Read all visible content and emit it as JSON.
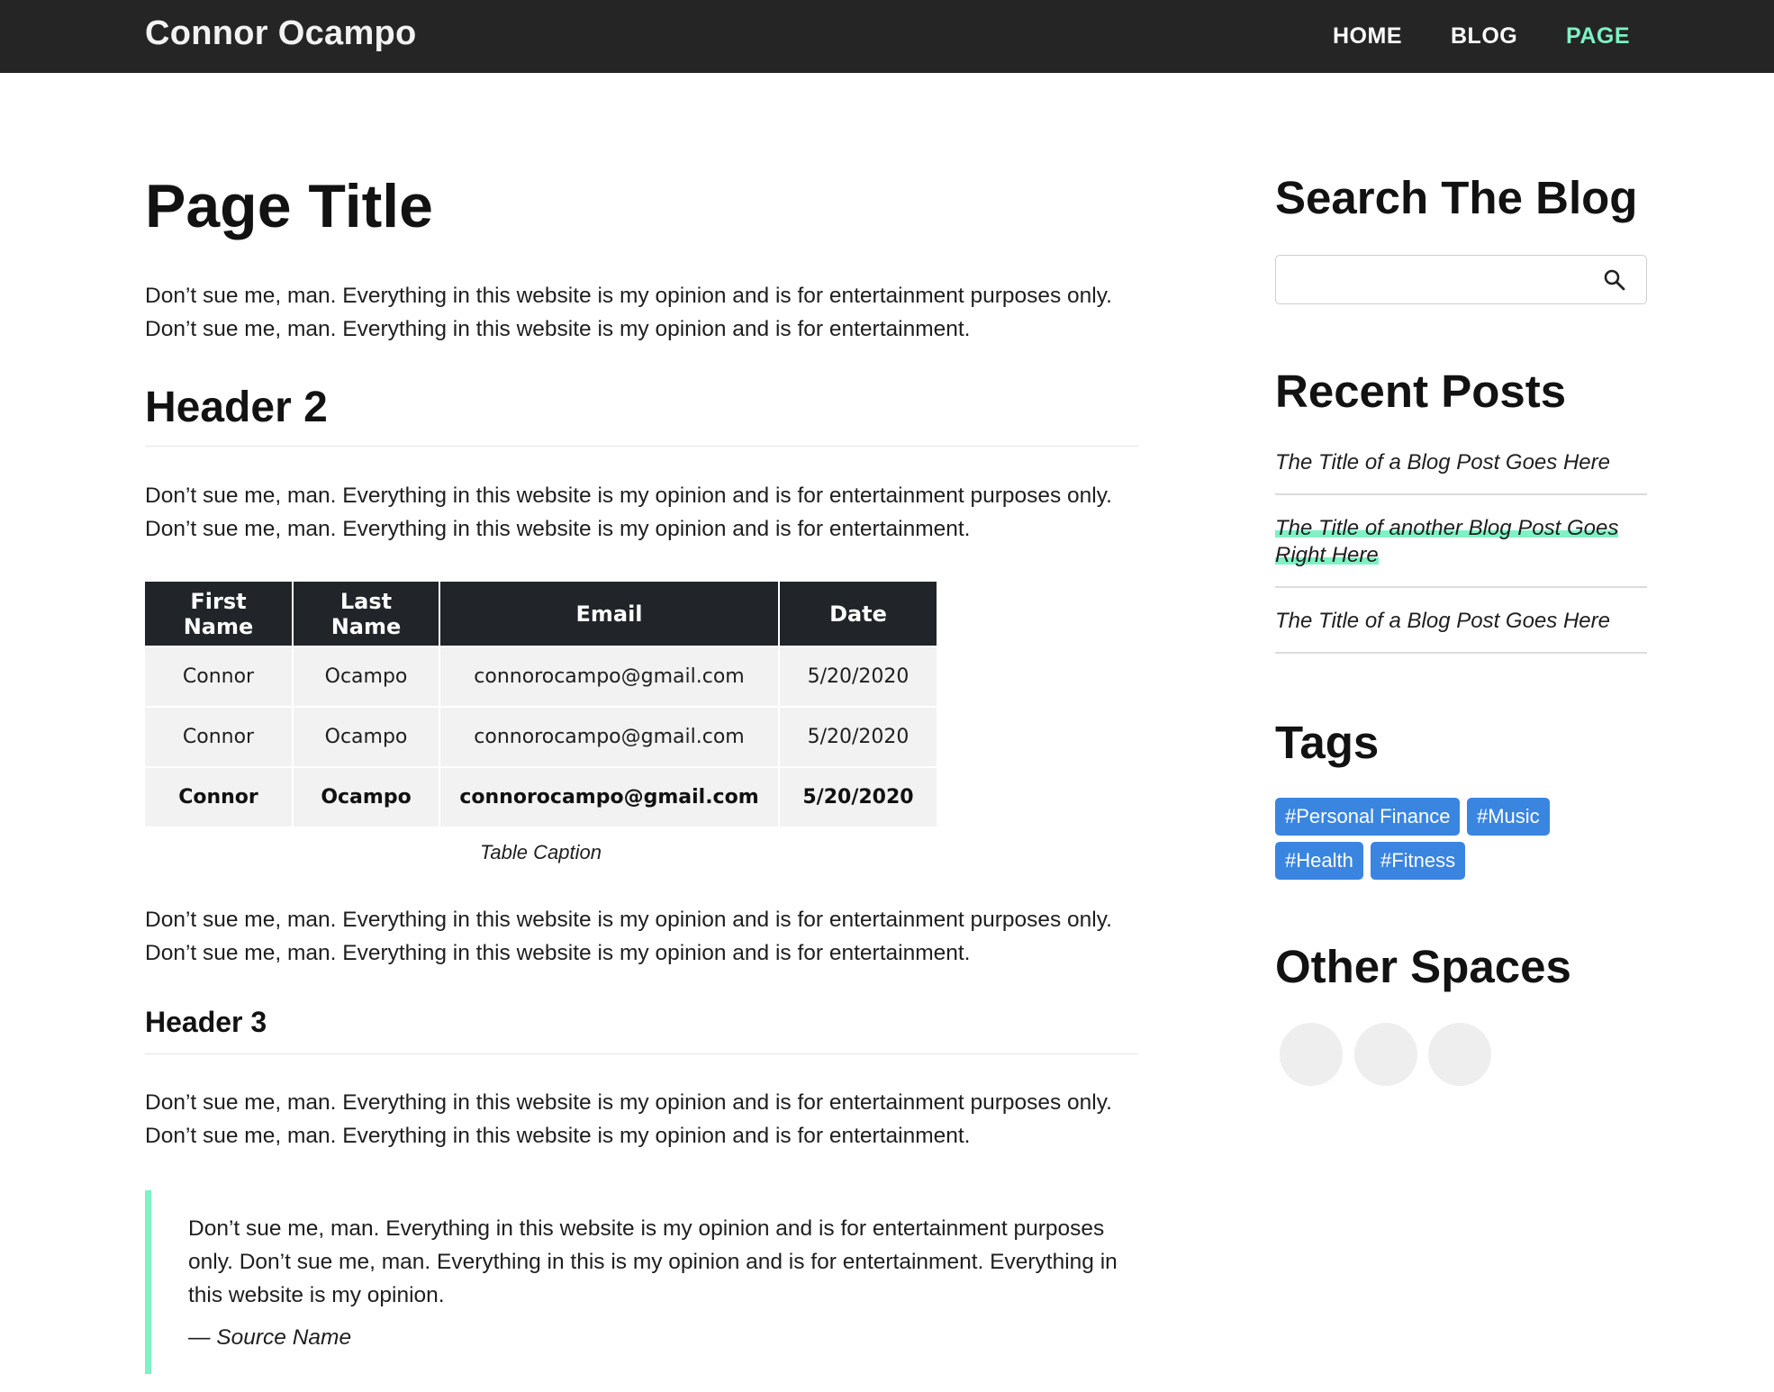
{
  "header": {
    "brand": "Connor Ocampo",
    "nav": [
      {
        "label": "HOME",
        "active": false
      },
      {
        "label": "BLOG",
        "active": false
      },
      {
        "label": "PAGE",
        "active": true
      }
    ]
  },
  "main": {
    "title": "Page Title",
    "paragraphs": [
      "Don’t sue me, man. Everything in this website is my opinion and is for entertainment purposes only. Don’t sue me, man. Everything in this website is my opinion and is for entertainment.",
      "Don’t sue me, man. Everything in this website is my opinion and is for entertainment purposes only. Don’t sue me, man. Everything in this website is my opinion and is for entertainment.",
      "Don’t sue me, man. Everything in this website is my opinion and is for entertainment purposes only. Don’t sue me, man. Everything in this website is my opinion and is for entertainment.",
      "Don’t sue me, man. Everything in this website is my opinion and is for entertainment purposes only. Don’t sue me, man. Everything in this website is my opinion and is for entertainment."
    ],
    "header2": "Header 2",
    "header3": "Header 3",
    "table": {
      "columns": [
        "First Name",
        "Last Name",
        "Email",
        "Date"
      ],
      "rows": [
        [
          "Connor",
          "Ocampo",
          "connorocampo@gmail.com",
          "5/20/2020"
        ],
        [
          "Connor",
          "Ocampo",
          "connorocampo@gmail.com",
          "5/20/2020"
        ],
        [
          "Connor",
          "Ocampo",
          "connorocampo@gmail.com",
          "5/20/2020"
        ]
      ],
      "caption": "Table Caption"
    },
    "quote": {
      "text": "Don’t sue me, man. Everything in this website is my opinion and is for entertainment purposes only. Don’t sue me, man. Everything in this is my opinion and is for entertainment. Everything in this website is my opinion.",
      "source": "— Source Name"
    }
  },
  "sidebar": {
    "search_heading": "Search The Blog",
    "search_placeholder": "",
    "recent_heading": "Recent Posts",
    "recent_posts": [
      "The Title of a Blog Post Goes Here",
      "The Title of another Blog Post Goes Right Here",
      "The Title of a Blog Post Goes Here"
    ],
    "tags_heading": "Tags",
    "tags": [
      "#Personal Finance",
      "#Music",
      "#Health",
      "#Fitness"
    ],
    "other_heading": "Other Spaces"
  },
  "colors": {
    "accent": "#7ef2c4",
    "header_bg": "#252526",
    "tag_bg": "#3a85e0"
  }
}
